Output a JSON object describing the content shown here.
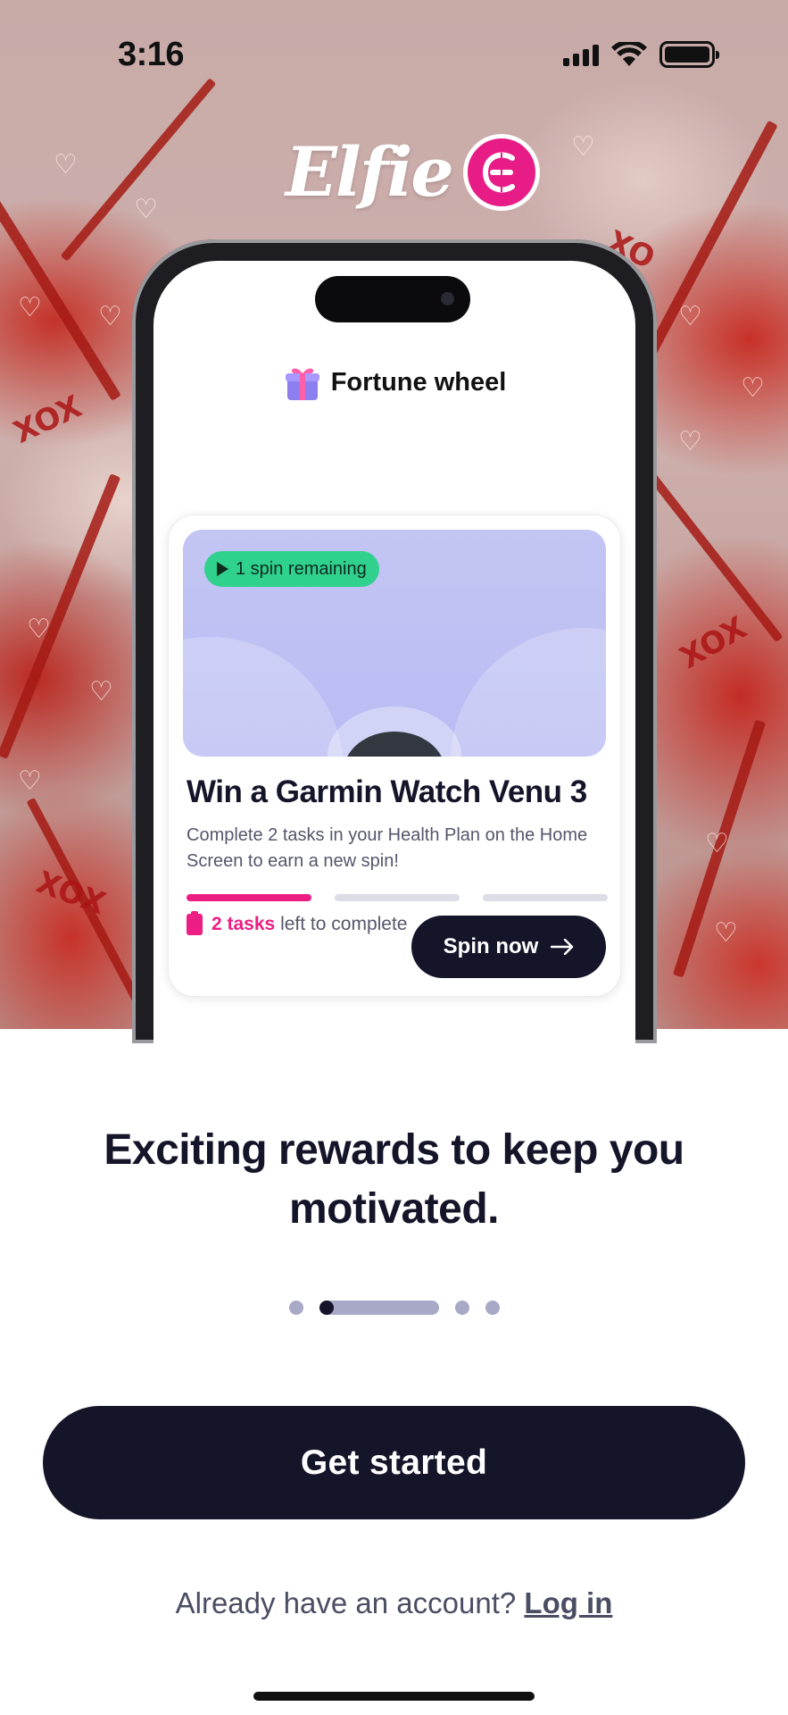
{
  "status_bar": {
    "time": "3:16",
    "icons": [
      "cellular-signal-icon",
      "wifi-icon",
      "battery-icon"
    ]
  },
  "brand": {
    "name": "Elfie",
    "mark": "Є",
    "accent": "#e81c87"
  },
  "mockup": {
    "screen_title": "Fortune wheel",
    "title_icon": "gift-icon",
    "card": {
      "badge": "1 spin remaining",
      "heading": "Win a Garmin Watch Venu 3",
      "description": "Complete 2 tasks in your Health Plan on the Home Screen to earn a new spin!",
      "progress_steps": 3,
      "progress_completed": 1,
      "tasks_count": "2 tasks",
      "tasks_suffix": "left to complete",
      "button_label": "Spin now"
    }
  },
  "onboarding": {
    "headline": "Exciting rewards to keep you motivated.",
    "page_indicator": {
      "total": 4,
      "active": 2
    },
    "primary_button": "Get started",
    "login_prompt": "Already have an account?",
    "login_link": "Log in"
  },
  "colors": {
    "dark": "#15152a",
    "pink": "#ec1d83",
    "green_badge": "#2fd18d",
    "indicator": "#a7a9c6"
  }
}
